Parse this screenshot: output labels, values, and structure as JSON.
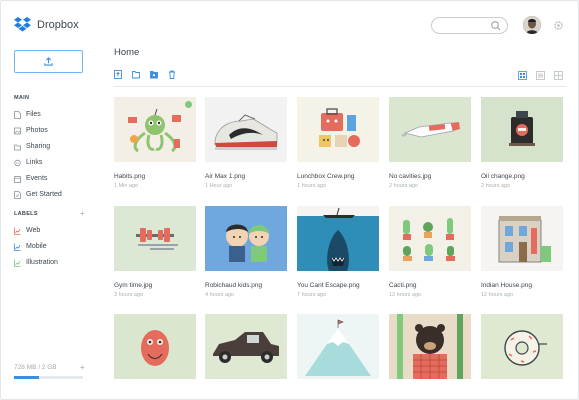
{
  "app": {
    "name": "Dropbox"
  },
  "sidebar": {
    "main_label": "MAIN",
    "items": [
      {
        "label": "Files",
        "icon": "file-icon"
      },
      {
        "label": "Photos",
        "icon": "photo-icon"
      },
      {
        "label": "Sharing",
        "icon": "sharing-icon"
      },
      {
        "label": "Links",
        "icon": "link-icon"
      },
      {
        "label": "Events",
        "icon": "events-icon"
      },
      {
        "label": "Get Started",
        "icon": "get-started-icon"
      }
    ],
    "labels_label": "LABELS",
    "add_symbol": "+",
    "labels": [
      {
        "label": "Web",
        "icon": "chart-icon",
        "color": "#e56b5c"
      },
      {
        "label": "Mobile",
        "icon": "chart-icon",
        "color": "#3d8ee0"
      },
      {
        "label": "Illustration",
        "icon": "chart-icon",
        "color": "#7fc97c"
      }
    ],
    "storage": {
      "text": "728 MB / 2 GB",
      "plus": "+",
      "used_fraction": 0.36
    }
  },
  "main": {
    "title": "Home",
    "files": [
      {
        "name": "Habits.png",
        "meta": "1 Min ago",
        "bg": "#f4efe6",
        "shared": true
      },
      {
        "name": "Air Max 1.png",
        "meta": "1 Hour ago",
        "bg": "#f2f2f2",
        "shared": false
      },
      {
        "name": "Lunchbox Crew.png",
        "meta": "1 hours ago",
        "bg": "#f5f2e8",
        "shared": false
      },
      {
        "name": "No cavities.jpg",
        "meta": "2 hours ago",
        "bg": "#dbe6d0",
        "shared": false
      },
      {
        "name": "Oil change.png",
        "meta": "2 hours ago",
        "bg": "#d6e3cc",
        "shared": false
      },
      {
        "name": "Gym time.jpg",
        "meta": "3 hours ago",
        "bg": "#dce8d3",
        "shared": false
      },
      {
        "name": "Robichaud kids.png",
        "meta": "4 hours ago",
        "bg": "#6fa7df",
        "shared": false
      },
      {
        "name": "You Cant Escape.png",
        "meta": "7 hours ago",
        "bg": "#2f8eb8",
        "shared": false
      },
      {
        "name": "Cacti.png",
        "meta": "12 hours ago",
        "bg": "#f3f0e8",
        "shared": false
      },
      {
        "name": "Indian House.png",
        "meta": "12 hours ago",
        "bg": "#f5f4f0",
        "shared": false
      },
      {
        "name": "",
        "meta": "",
        "bg": "#dbe6cf",
        "shared": false
      },
      {
        "name": "",
        "meta": "",
        "bg": "#dfe8d3",
        "shared": false
      },
      {
        "name": "",
        "meta": "",
        "bg": "#eef6f5",
        "shared": false
      },
      {
        "name": "",
        "meta": "",
        "bg": "#e8dcc8",
        "shared": false
      },
      {
        "name": "",
        "meta": "",
        "bg": "#dfe8d1",
        "shared": false
      }
    ]
  },
  "colors": {
    "accent": "#3d8ee0",
    "text": "#3d464d",
    "muted": "#a7b0b6"
  }
}
